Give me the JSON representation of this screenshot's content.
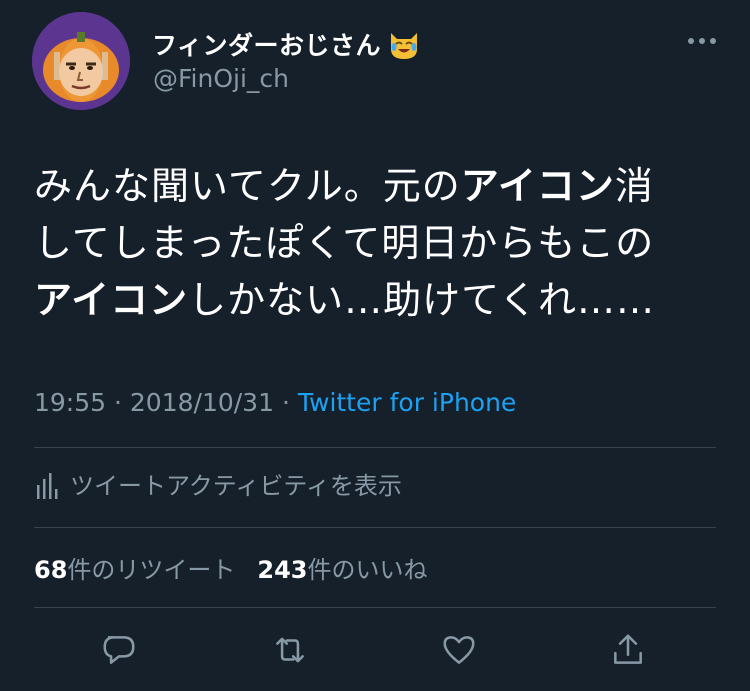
{
  "tweet": {
    "author_name": "フィンダーおじさん",
    "author_emoji": "😹",
    "author_handle": "@FinOji_ch",
    "text": {
      "line1_a": "みんな聞いてクル。元の",
      "line1_b": "アイコン",
      "line1_c": "消",
      "line2": "してしまったぽくて明日からもこの",
      "line3_a": "アイコン",
      "line3_b": "しかない…助けてくれ……"
    },
    "time": "19:55",
    "date": "2018/10/31",
    "separator": "·",
    "source": "Twitter for iPhone"
  },
  "activity_label": "ツイートアクティビティを表示",
  "stats": {
    "retweets_count": "68",
    "retweets_label": "件のリツイート",
    "likes_count": "243",
    "likes_label": "件のいいね"
  },
  "icons": {
    "avatar": "pumpkin-face-avatar",
    "emoji": "cat-tears-of-joy-emoji",
    "more": "more-dots-icon",
    "activity": "bar-chart-icon",
    "reply": "reply-bubble-icon",
    "retweet": "retweet-icon",
    "like": "heart-icon",
    "share": "share-icon"
  },
  "colors": {
    "background": "#15202b",
    "text_primary": "#ffffff",
    "text_secondary": "#8899a6",
    "link": "#1da1f2",
    "divider": "#38444d"
  }
}
